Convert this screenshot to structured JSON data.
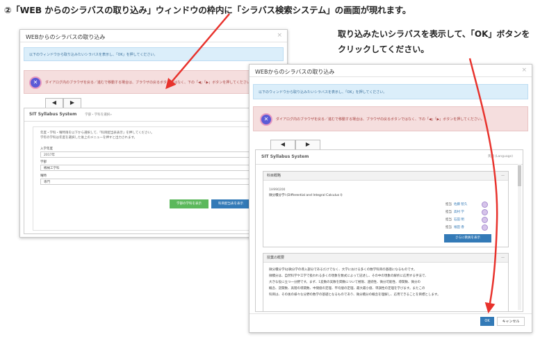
{
  "heading": "②「WEB からのシラバスの取り込み」ウィンドウの枠内に「シラバス検索システム」の画面が現れます。",
  "instruction": {
    "line1": "取り込みたいシラバスを表示して、「OK」ボタンを",
    "line2": "クリックしてください。"
  },
  "dialog": {
    "title": "WEBからのシラバスの取り込み",
    "close": "×",
    "info": "以下のウィンドウから取り込みたいシラバスを表示し、「OK」を押してください。",
    "warn": "ダイアログ内のブラウザを戻る／進むで移動する場合は、ブラウザの戻るボタンではなく、下の「◀」「▶」ボタンを押してください。",
    "nav_prev": "◀",
    "nav_next": "▶"
  },
  "search": {
    "system_title": "SIT Syllabus System",
    "breadcrumb": "学部・学科を選択»",
    "help1": "年度・学科・曜時限を以下から選択して、「科目配当表表示」を押してください。",
    "help2": "学年の学科は年度を選択した後上のメニューを押すと出力されます。",
    "year_label": "入学年度",
    "year_value": "2017年",
    "faculty_label": "学部",
    "faculty_value": "機械工学科",
    "term_label": "曜時",
    "term_value": "専門",
    "btn_green": "学部の学科を表示",
    "btn_blue": "科目配当表を表示"
  },
  "detail": {
    "system_title": "SIT Syllabus System",
    "lang": "英語 (Language)",
    "subject_panel": "科目概略",
    "subject_code": "1H990200",
    "subject_name": "微分積分学Ⅰ (Differential and Integral Calculus I)",
    "teachers": [
      {
        "role": "担当",
        "name": "佐藤 智久"
      },
      {
        "role": "担当",
        "name": "高村 学"
      },
      {
        "role": "担当",
        "name": "石田 明"
      },
      {
        "role": "担当",
        "name": "福田 香"
      }
    ],
    "more_button": "さらに教員を表示",
    "overview_panel": "授業の概要",
    "overview_lines": [
      "微分積分学Ⅰは微分学の導入部分であるだけでなく、大学における多くの数学科目の基礎になるものです。",
      "微積分は、自然科学や工学で扱われる多くの現象を数式によって記述し、その中の現象の解析に応用する手法で、",
      "大きな役に立つ一分野です。まず、1変数の実数を関数について極限、連続性、微分可能性、導関数、微分の",
      "概念、逆関数、高階の導関数、中間値の定理、平均値の定理、最大最小値、単調性の定理を学びます。またこの",
      "科目は、その後の様々な分野の数学の基礎となるものであり、微分積分の概念を理解し、応用できることを目標とします。"
    ],
    "ok_button": "OK",
    "cancel_button": "キャンセル"
  },
  "colors": {
    "arrow": "#e8322c",
    "primary": "#337ab7",
    "success": "#5cb85c"
  }
}
